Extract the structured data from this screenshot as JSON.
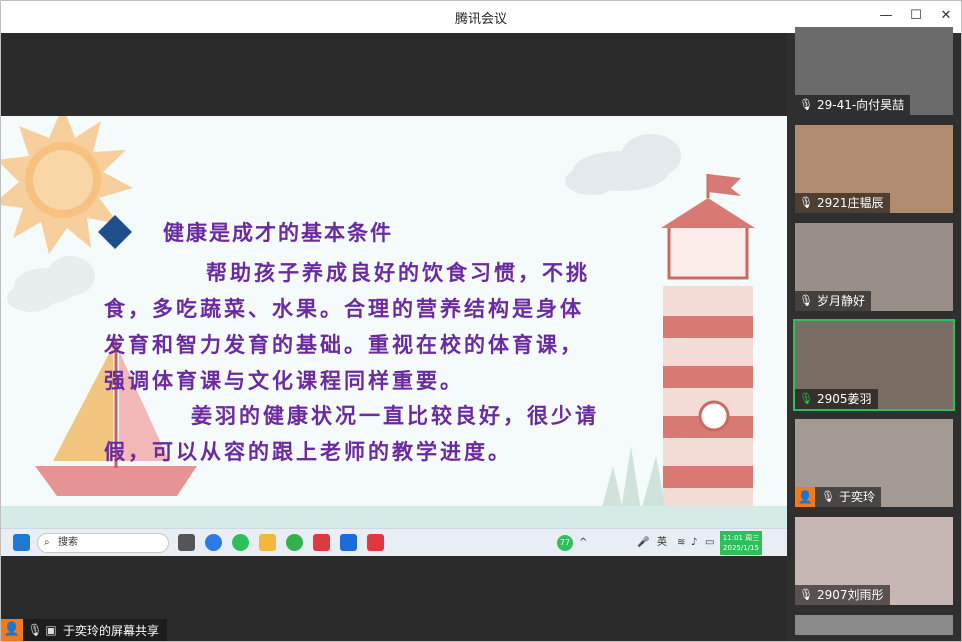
{
  "window": {
    "title": "腾讯会议",
    "minimize_glyph": "—",
    "maximize_glyph": "☐",
    "close_glyph": "✕"
  },
  "slide": {
    "heading": "健康是成才的基本条件",
    "lines": [
      "帮助孩子养成良好的饮食习惯，不挑",
      "食，多吃蔬菜、水果。合理的营养结构是身体",
      "发育和智力发育的基础。重视在校的体育课，",
      "强调体育课与文化课程同样重要。",
      "姜羽的健康状况一直比较良好，很少请",
      "假，可以从容的跟上老师的教学进度。"
    ]
  },
  "taskbar": {
    "search_label": "搜索",
    "badge_count": "77",
    "ime_label": "英",
    "clock_time": "11:01 周三",
    "clock_date": "2025/1/15"
  },
  "presenter": {
    "label": "于奕玲的屏幕共享"
  },
  "participants": [
    {
      "name": "29-41-向付昊喆",
      "mic": "muted",
      "color": "#6b6b6b"
    },
    {
      "name": "2921庄韫辰",
      "mic": "muted",
      "color": "#b08b70"
    },
    {
      "name": "岁月静好",
      "mic": "muted",
      "color": "#9a8f88"
    },
    {
      "name": "2905姜羽",
      "mic": "on",
      "color": "#7a6d63"
    },
    {
      "name": "于奕玲",
      "mic": "muted",
      "color": "#a39a94",
      "has_avatar": true
    },
    {
      "name": "2907刘雨彤",
      "mic": "muted",
      "color": "#c7b7b4"
    }
  ],
  "colors": {
    "slide_text": "#6a2aa0",
    "active_border": "#2fbf5a",
    "avatar_orange": "#f27a1a",
    "diamond": "#1f4e8c"
  }
}
